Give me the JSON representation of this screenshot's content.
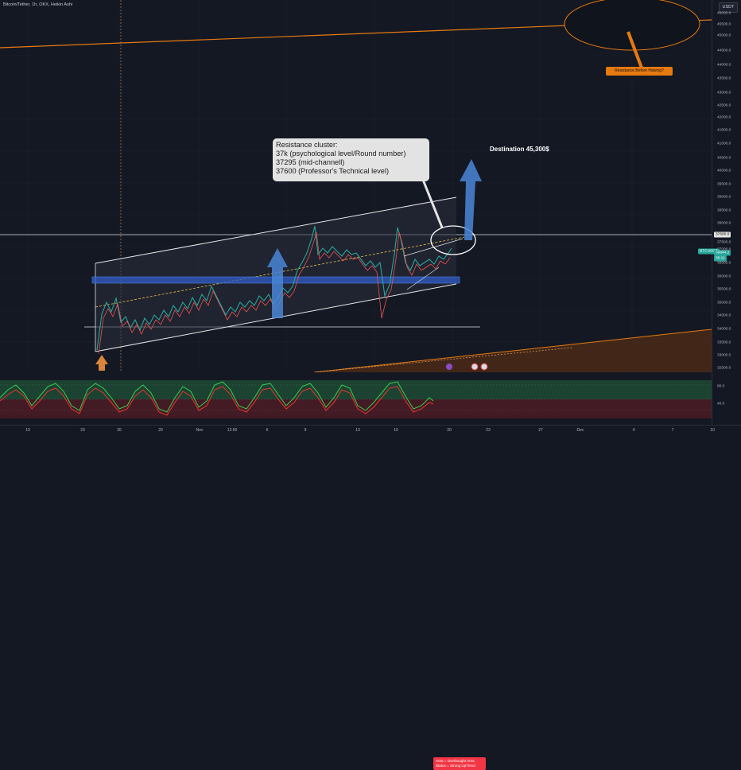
{
  "header": {
    "symbol_title": "Bitcoin/Tether, 1h, OKX, Heikin Ashi",
    "currency_label": "USDT"
  },
  "annotations": {
    "callout_lines": [
      "Resistance cluster:",
      "37k (psychological level/Round number)",
      "37295 (mid-channell)",
      "37600 (Professor's Technical level)"
    ],
    "destination_label": "Destination 45,300$",
    "halving_label": "Resistance Before Halving?"
  },
  "price_axis": {
    "ticks": [
      "46000.0",
      "45500.0",
      "45000.0",
      "44500.0",
      "44000.0",
      "43500.0",
      "43000.0",
      "42500.0",
      "42000.0",
      "41500.0",
      "41000.0",
      "40500.0",
      "40000.0",
      "39500.0",
      "39000.0",
      "38500.0",
      "38000.0",
      "37500.0",
      "37000.0",
      "36500.0",
      "36000.0",
      "35500.0",
      "35000.0",
      "34500.0",
      "34000.0",
      "33500.0",
      "33000.0",
      "32500.0"
    ],
    "level_tag": "37600.0",
    "symbol_tag": "BTCUSDT",
    "last_price": "36844.2",
    "countdown": "36:11"
  },
  "oscillator": {
    "ticks": [
      "80.0",
      "40.0"
    ],
    "tag_lines": [
      "Area = Overbought Area",
      "Status =   Strong UpTrend"
    ]
  },
  "time_axis": {
    "labels": [
      "19",
      "23",
      "26",
      "29",
      "Nov",
      "12:00",
      "6",
      "9",
      "13",
      "16",
      "20",
      "23",
      "27",
      "Dec",
      "4",
      "7",
      "10"
    ]
  },
  "colors": {
    "background": "#141823",
    "bull_candle": "#26a69a",
    "bear_candle": "#ef5350",
    "resistance_orange": "#e67a10",
    "support_blue": "#2f5ec7",
    "arrow_blue": "#4a86d6",
    "price_tag_green": "#26a69a"
  },
  "icons": [
    "price-scale-icon",
    "event-icon",
    "flag-icon"
  ]
}
